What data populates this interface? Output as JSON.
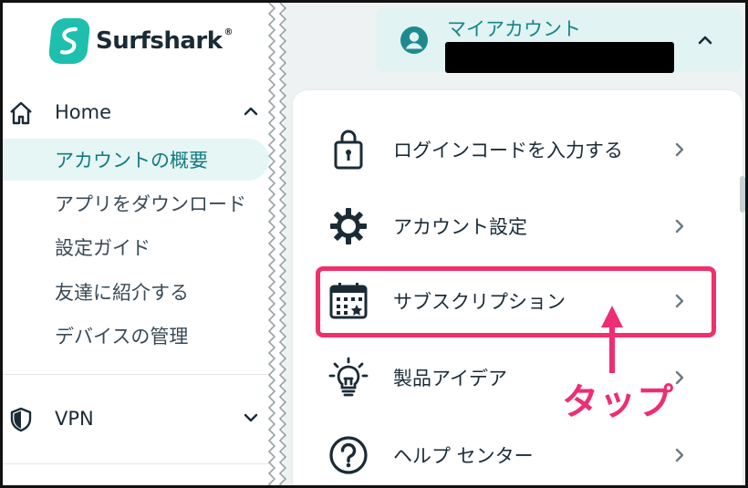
{
  "brand": {
    "name": "Surfshark",
    "reg": "®",
    "accent": "#1ebfae"
  },
  "sidebar": {
    "home": {
      "label": "Home",
      "icon": "home-icon",
      "expanded": true
    },
    "items": [
      {
        "label": "アカウントの概要",
        "active": true
      },
      {
        "label": "アプリをダウンロード",
        "active": false
      },
      {
        "label": "設定ガイド",
        "active": false
      },
      {
        "label": "友達に紹介する",
        "active": false
      },
      {
        "label": "デバイスの管理",
        "active": false
      }
    ],
    "vpn": {
      "label": "VPN",
      "icon": "shield-icon",
      "expanded": false
    }
  },
  "account": {
    "label": "マイアカウント",
    "icon": "user-circle-icon",
    "expanded": true
  },
  "menu": {
    "items": [
      {
        "label": "ログインコードを入力する",
        "icon": "lock-icon"
      },
      {
        "label": "アカウント設定",
        "icon": "gear-icon"
      },
      {
        "label": "サブスクリプション",
        "icon": "calendar-icon"
      },
      {
        "label": "製品アイデア",
        "icon": "lightbulb-icon"
      },
      {
        "label": "ヘルプ センター",
        "icon": "help-icon"
      }
    ]
  },
  "annotation": {
    "label": "タップ",
    "color": "#ee2d74",
    "highlight_color": "#f0306a"
  }
}
